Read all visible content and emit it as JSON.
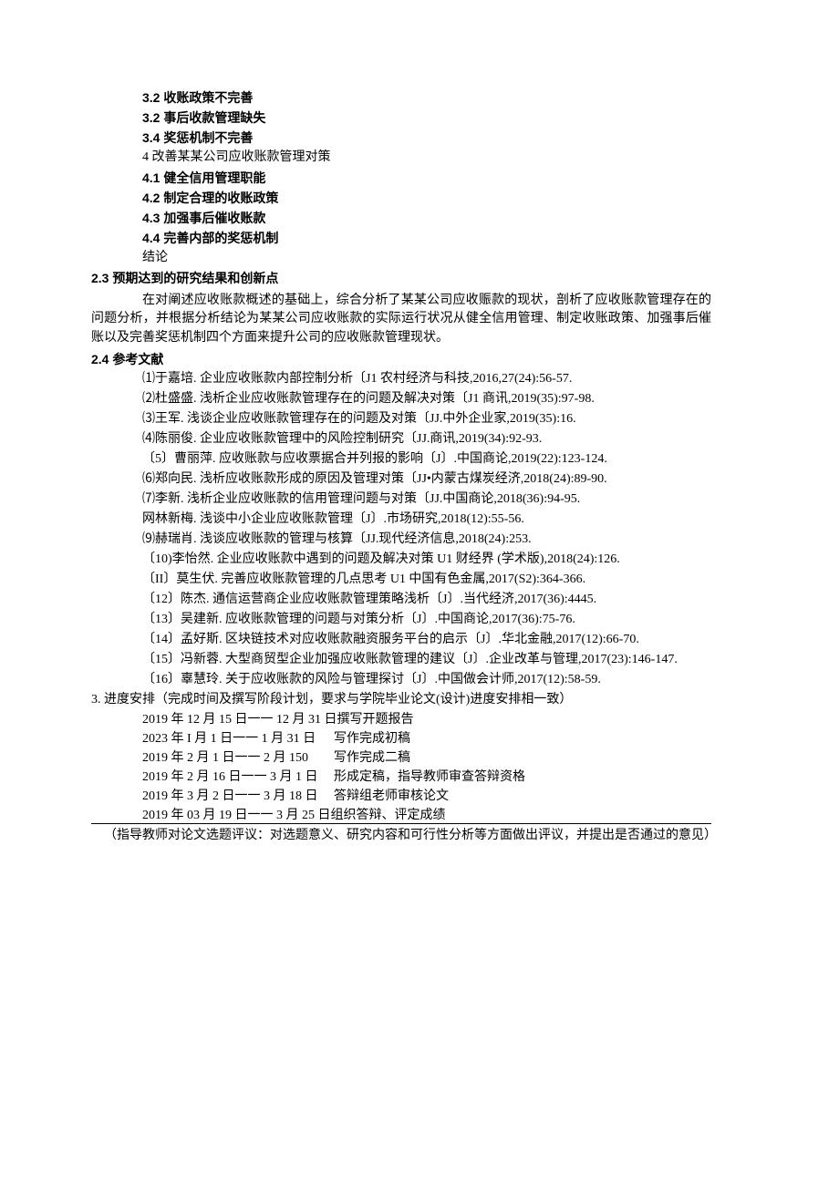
{
  "outline": {
    "s32a": "3.2 收账政策不完善",
    "s32b": "3.2 事后收款管理缺失",
    "s34": "3.4 奖惩机制不完善",
    "s4": "4 改善某某公司应收账款管理对策",
    "s41": "4.1    健全信用管理职能",
    "s42": "4.2    制定合理的收账政策",
    "s43": "4.3    加强事后催收账款",
    "s44": "4.4    完善内部的奖惩机制",
    "conclusion": "结论"
  },
  "sec23": {
    "heading": "2.3    预期达到的研究结果和创新点",
    "para": "在对阐述应收账款概述的基础上，综合分析了某某公司应收赈款的现状，剖析了应收账款管理存在的问题分析，并根据分析结论为某某公司应收账款的实际运行状况从健全信用管理、制定收账政策、加强事后催账以及完善奖惩机制四个方面来提升公司的应收账款管理现状。"
  },
  "sec24": {
    "heading": "2.4    参考文献",
    "refs": [
      "⑴于嘉培. 企业应收账款内部控制分析〔J1 农村经济与科技,2016,27(24):56-57.",
      "⑵杜盛盛. 浅析企业应收账款管理存在的问题及解决对策〔J1 商讯,2019(35):97-98.",
      "⑶王军. 浅谈企业应收账款管理存在的问题及对策〔JJ.中外企业家,2019(35):16.",
      "⑷陈丽俊. 企业应收账款管理中的风险控制研究〔JJ.商讯,2019(34):92-93.",
      "〔5〕曹丽萍. 应收账款与应收票据合并列报的影响〔J〕.中国商论,2019(22):123-124.",
      "⑹郑向民. 浅析应收账款形成的原因及管理对策〔JJ•内蒙古煤炭经济,2018(24):89-90.",
      "⑺李新. 浅析企业应收账款的信用管理问题与对策〔JJ.中国商论,2018(36):94-95.",
      "网林新梅. 浅谈中小企业应收账款管理〔J〕.市场研究,2018(12):55-56.",
      "⑼赫瑞肖. 浅谈应收账款的管理与核算〔JJ.现代经济信息,2018(24):253.",
      "〔10)李怡然. 企业应收账款中遇到的问题及解决对策 U1 财经界 (学术版),2018(24):126.",
      "〔II〕莫生伏. 完善应收账款管理的几点思考 U1 中国有色金属,2017(S2):364-366.",
      "〔12〕陈杰. 通信运营商企业应收账款管理策略浅析〔J〕.当代经济,2017(36):4445.",
      "〔13〕吴建新. 应收账款管理的问题与对策分析〔J〕.中国商论,2017(36):75-76.",
      "〔14〕孟好斯. 区块链技术对应收账款融资服务平台的启示〔J〕.华北金融,2017(12):66-70.",
      "〔15〕冯新蓉. 大型商贸型企业加强应收账款管理的建议〔J〕.企业改革与管理,2017(23):146-147.",
      "〔16〕辜慧玲. 关于应收账款的风险与管理探讨〔J〕.中国做会计师,2017(12):58-59."
    ]
  },
  "sec3": {
    "heading": "3. 进度安排（完成时间及撰写阶段计划，要求与学院毕业论文(设计)进度安排相一致）",
    "rows": [
      {
        "date": "2019 年 12 月 15 日一一 12 月 31 日撰写开题报告",
        "desc": ""
      },
      {
        "date": "2023 年 I 月 1 日一一 1 月 31 日",
        "desc": "写作完成初稿"
      },
      {
        "date": "2019 年 2 月 1 日一一 2 月 150",
        "desc": "写作完成二稿"
      },
      {
        "date": "2019 年 2 月 16 日一一 3 月 1 日",
        "desc": "形成定稿，指导教师审查答辩资格"
      },
      {
        "date": "2019 年 3 月 2 日一一 3 月 18 日",
        "desc": "答辩组老师审核论文"
      },
      {
        "date": "2019 年 03 月 19 日一一 3 月 25 日组织答辩、评定成绩",
        "desc": ""
      }
    ]
  },
  "footer": "（指导教师对论文选题评议：对选题意义、研究内容和可行性分析等方面做出评议，并提出是否通过的意见）"
}
